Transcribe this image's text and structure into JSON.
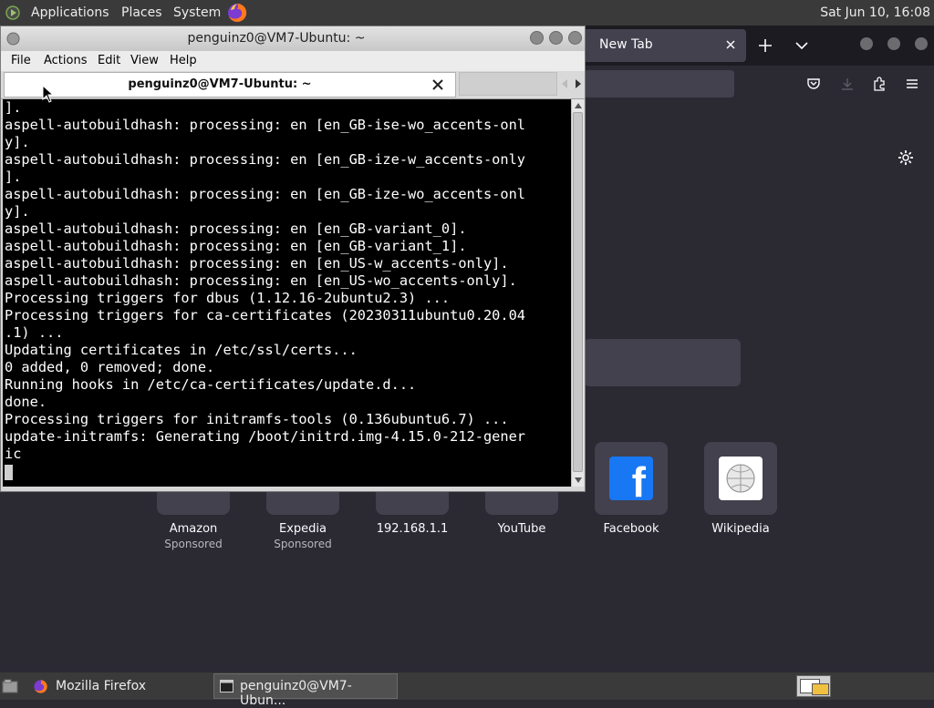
{
  "top_panel": {
    "menus": [
      "Applications",
      "Places",
      "System"
    ],
    "clock": "Sat Jun 10, 16:08"
  },
  "firefox": {
    "tab_title": "New Tab",
    "shortcuts": [
      {
        "name": "Amazon",
        "sponsor": "Sponsored"
      },
      {
        "name": "Expedia",
        "sponsor": "Sponsored"
      },
      {
        "name": "192.168.1.1",
        "sponsor": ""
      },
      {
        "name": "YouTube",
        "sponsor": ""
      },
      {
        "name": "Facebook",
        "sponsor": ""
      },
      {
        "name": "Wikipedia",
        "sponsor": ""
      }
    ],
    "facebook_logo": "f",
    "colors": {
      "bg": "#2b2a33",
      "tile": "#42414d",
      "facebook": "#1877f2"
    }
  },
  "terminal": {
    "title": "penguinz0@VM7-Ubuntu: ~",
    "menu": [
      "File",
      "Actions",
      "Edit",
      "View",
      "Help"
    ],
    "tab_label": "penguinz0@VM7-Ubuntu: ~",
    "lines": [
      "].",
      "aspell-autobuildhash: processing: en [en_GB-ise-wo_accents-onl",
      "y].",
      "aspell-autobuildhash: processing: en [en_GB-ize-w_accents-only",
      "].",
      "aspell-autobuildhash: processing: en [en_GB-ize-wo_accents-onl",
      "y].",
      "aspell-autobuildhash: processing: en [en_GB-variant_0].",
      "aspell-autobuildhash: processing: en [en_GB-variant_1].",
      "aspell-autobuildhash: processing: en [en_US-w_accents-only].",
      "aspell-autobuildhash: processing: en [en_US-wo_accents-only].",
      "Processing triggers for dbus (1.12.16-2ubuntu2.3) ...",
      "Processing triggers for ca-certificates (20230311ubuntu0.20.04",
      ".1) ...",
      "Updating certificates in /etc/ssl/certs...",
      "0 added, 0 removed; done.",
      "Running hooks in /etc/ca-certificates/update.d...",
      "done.",
      "Processing triggers for initramfs-tools (0.136ubuntu6.7) ...",
      "update-initramfs: Generating /boot/initrd.img-4.15.0-212-gener",
      "ic"
    ]
  },
  "taskbar": {
    "tasks": [
      "Mozilla Firefox",
      "penguinz0@VM7-Ubun..."
    ]
  }
}
